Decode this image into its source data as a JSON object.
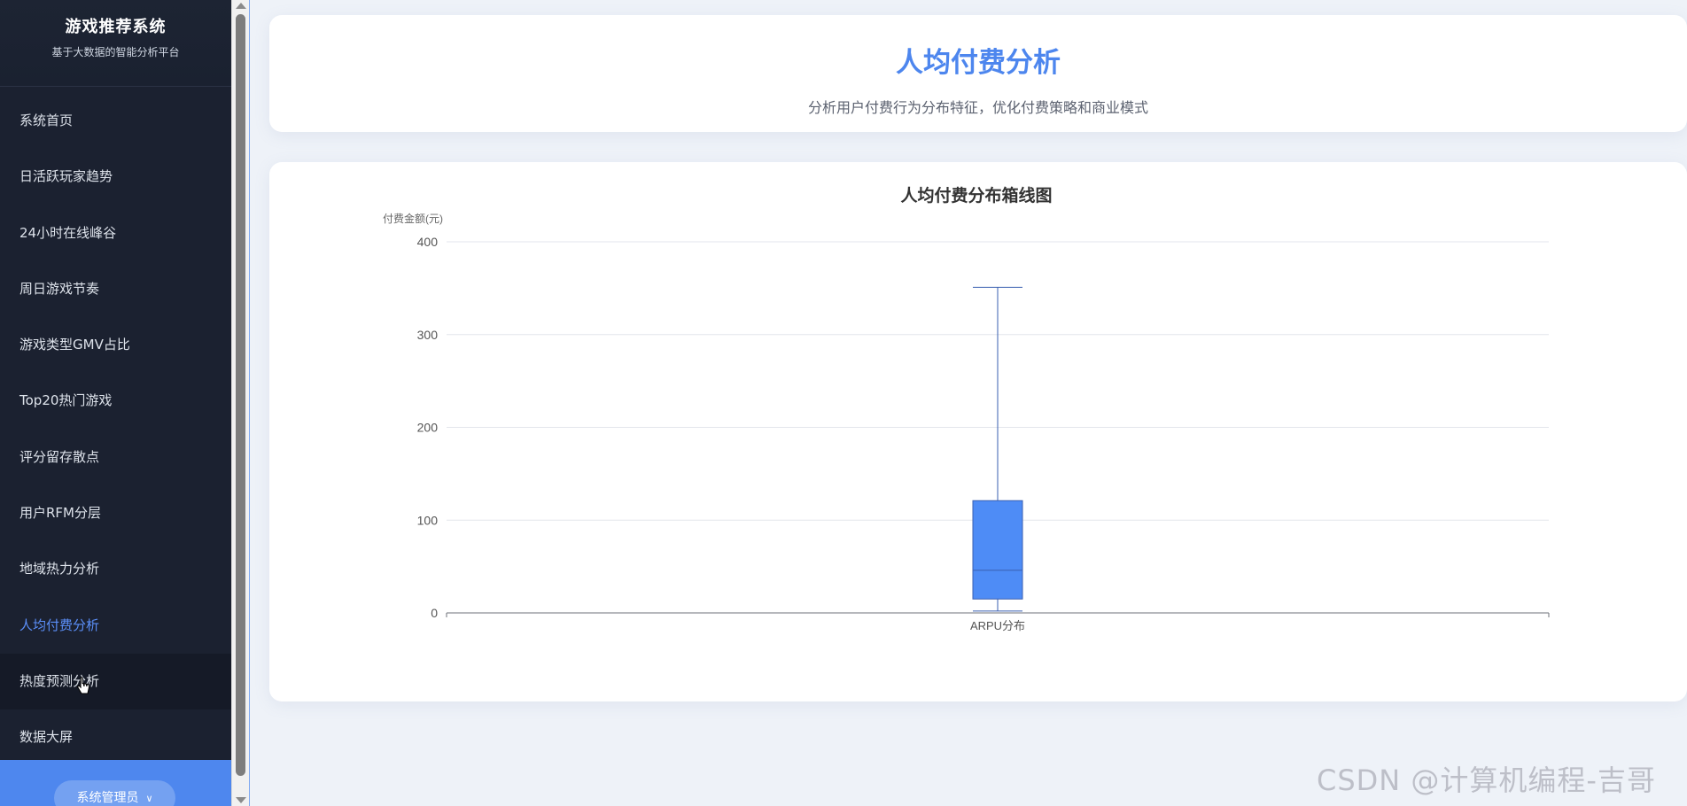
{
  "sidebar": {
    "title": "游戏推荐系统",
    "subtitle": "基于大数据的智能分析平台",
    "items": [
      {
        "label": "系统首页"
      },
      {
        "label": "日活跃玩家趋势"
      },
      {
        "label": "24小时在线峰谷"
      },
      {
        "label": "周日游戏节奏"
      },
      {
        "label": "游戏类型GMV占比"
      },
      {
        "label": "Top20热门游戏"
      },
      {
        "label": "评分留存散点"
      },
      {
        "label": "用户RFM分层"
      },
      {
        "label": "地域热力分析"
      },
      {
        "label": "人均付费分析"
      },
      {
        "label": "热度预测分析"
      },
      {
        "label": "数据大屏"
      }
    ],
    "active_index": 9,
    "hover_index": 10,
    "user_label": "系统管理员",
    "user_chevron_icon": "chevron-down-icon"
  },
  "header": {
    "title": "人均付费分析",
    "subtitle": "分析用户付费行为分布特征，优化付费策略和商业模式"
  },
  "chart_data": {
    "type": "boxplot",
    "title": "人均付费分布箱线图",
    "ylabel": "付费金额(元)",
    "xlabel": "",
    "ylim": [
      0,
      400
    ],
    "yticks": [
      0,
      100,
      200,
      300,
      400
    ],
    "grid": true,
    "categories": [
      "ARPU分布"
    ],
    "boxes": [
      {
        "category": "ARPU分布",
        "min": 2,
        "q1": 15,
        "median": 46,
        "q3": 121,
        "max": 351
      }
    ],
    "colors": {
      "box": "#4e8cf6",
      "line": "#3a5fb0",
      "grid": "#e3e6ec"
    }
  },
  "watermark": "CSDN @计算机编程-吉哥",
  "colors": {
    "accent": "#4d86ee",
    "sidebar_bg": "#1b2130",
    "active": "#5b8ff9"
  }
}
